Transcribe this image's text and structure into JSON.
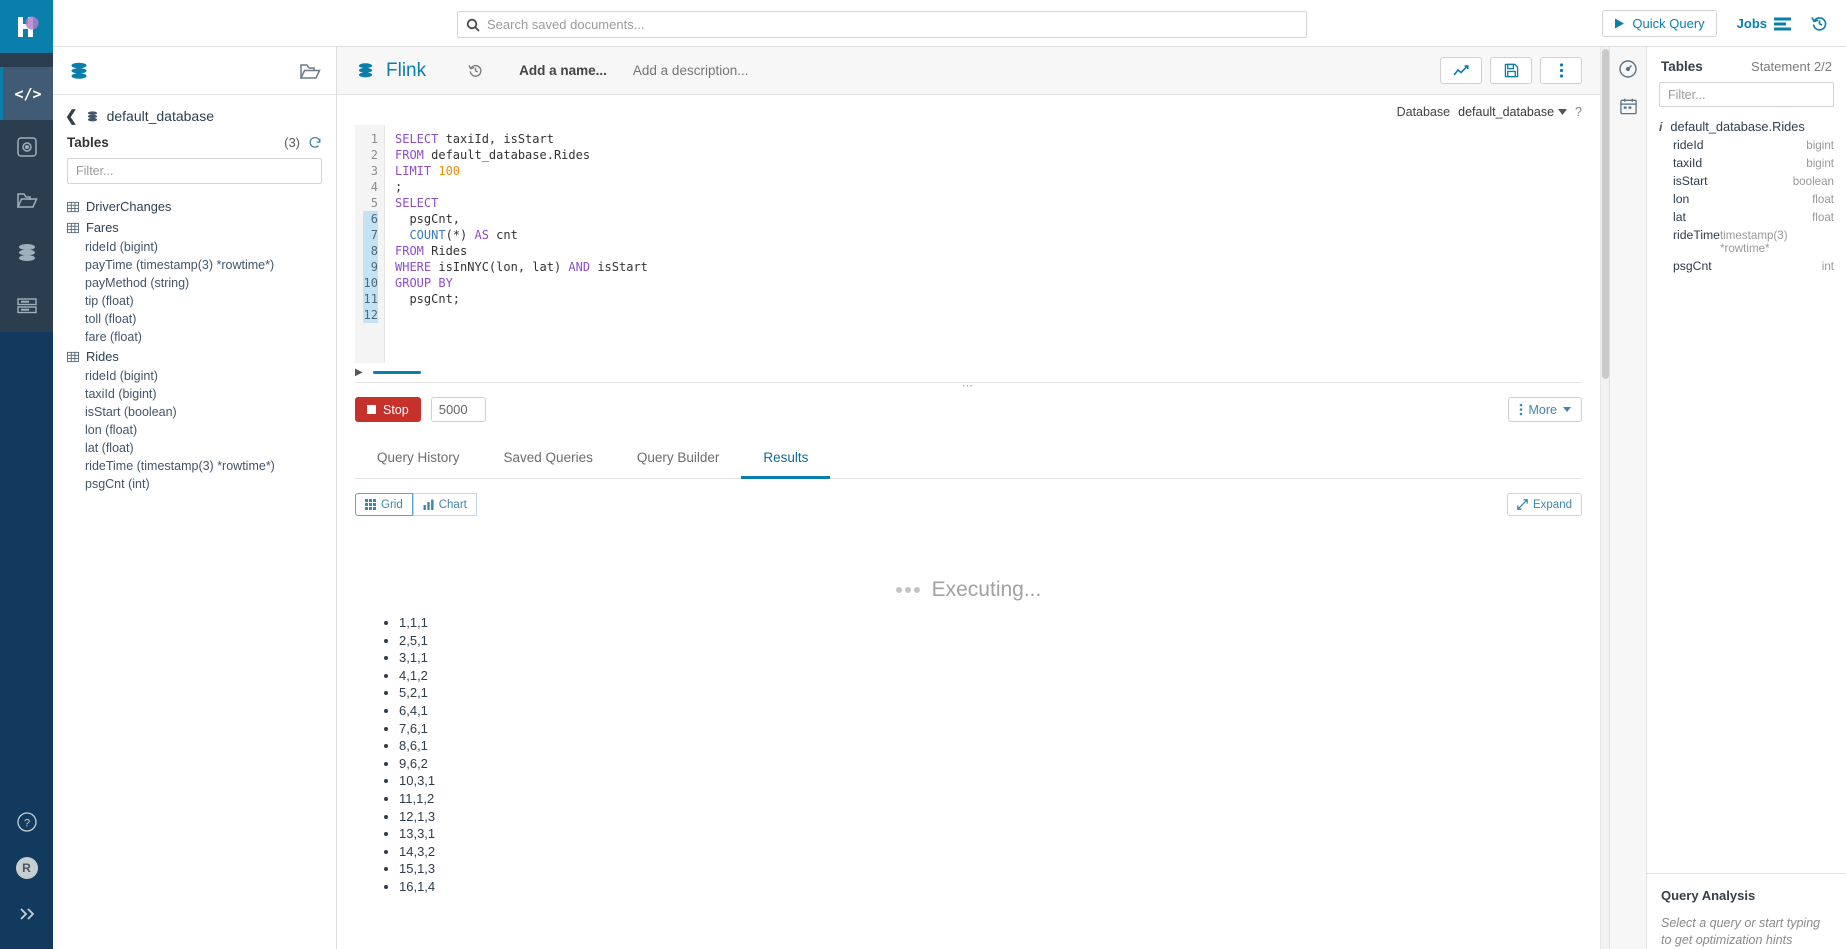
{
  "rail": {
    "logo": "hue-logo",
    "items": [
      {
        "name": "editor-icon",
        "glyph": "</>"
      },
      {
        "name": "dashboard-icon",
        "glyph": "dashboard"
      },
      {
        "name": "browser-icon",
        "glyph": "folder"
      },
      {
        "name": "tables-icon",
        "glyph": "database"
      },
      {
        "name": "jobs-icon",
        "glyph": "list"
      }
    ],
    "bottom": [
      {
        "name": "help-icon",
        "label": "?"
      },
      {
        "name": "user-avatar",
        "label": "R"
      },
      {
        "name": "expand-sidebar-icon",
        "label": "»"
      }
    ]
  },
  "topbar": {
    "search_placeholder": "Search saved documents...",
    "search_value": "",
    "quick_query_label": "Quick Query",
    "jobs_label": "Jobs",
    "history_icon": "history-icon"
  },
  "assist": {
    "open_folder_icon": "open-folder-icon",
    "db_icon": "database-icon",
    "database_name": "default_database",
    "tables_label": "Tables",
    "tables_count": "(3)",
    "refresh_icon": "refresh-icon",
    "filter_placeholder": "Filter...",
    "filter_value": "",
    "tables": [
      {
        "name": "DriverChanges",
        "columns": []
      },
      {
        "name": "Fares",
        "columns": [
          "rideId (bigint)",
          "payTime (timestamp(3) *rowtime*)",
          "payMethod (string)",
          "tip (float)",
          "toll (float)",
          "fare (float)"
        ]
      },
      {
        "name": "Rides",
        "columns": [
          "rideId (bigint)",
          "taxiId (bigint)",
          "isStart (boolean)",
          "lon (float)",
          "lat (float)",
          "rideTime (timestamp(3) *rowtime*)",
          "psgCnt (int)"
        ]
      }
    ]
  },
  "editor": {
    "title": "Flink",
    "history_icon": "history-icon",
    "name_placeholder": "Add a name...",
    "description_placeholder": "Add a description...",
    "actions": [
      {
        "name": "chart-toggle-button",
        "icon": "chart-line-icon"
      },
      {
        "name": "save-button",
        "icon": "save-disk-icon"
      },
      {
        "name": "more-options-button",
        "icon": "kebab-icon"
      }
    ],
    "database_label": "Database",
    "database_value": "default_database",
    "help_icon": "question-mark-icon",
    "code_lines": [
      {
        "n": 1,
        "selected": false,
        "tokens": [
          {
            "t": "SELECT",
            "c": "kw"
          },
          {
            "t": " taxiId, isStart",
            "c": "plain"
          }
        ]
      },
      {
        "n": 2,
        "selected": false,
        "tokens": [
          {
            "t": "FROM",
            "c": "kw"
          },
          {
            "t": " default_database.Rides",
            "c": "plain"
          }
        ]
      },
      {
        "n": 3,
        "selected": false,
        "tokens": [
          {
            "t": "LIMIT",
            "c": "kw"
          },
          {
            "t": " ",
            "c": "plain"
          },
          {
            "t": "100",
            "c": "num"
          }
        ]
      },
      {
        "n": 4,
        "selected": false,
        "tokens": [
          {
            "t": ";",
            "c": "plain"
          }
        ]
      },
      {
        "n": 5,
        "selected": false,
        "tokens": [
          {
            "t": "",
            "c": "plain"
          }
        ]
      },
      {
        "n": 6,
        "selected": true,
        "tokens": [
          {
            "t": "SELECT",
            "c": "kw"
          }
        ]
      },
      {
        "n": 7,
        "selected": true,
        "tokens": [
          {
            "t": "  psgCnt,",
            "c": "plain"
          }
        ]
      },
      {
        "n": 8,
        "selected": true,
        "tokens": [
          {
            "t": "  ",
            "c": "plain"
          },
          {
            "t": "COUNT",
            "c": "fn"
          },
          {
            "t": "(*) ",
            "c": "plain"
          },
          {
            "t": "AS",
            "c": "kw"
          },
          {
            "t": " cnt",
            "c": "plain"
          }
        ]
      },
      {
        "n": 9,
        "selected": true,
        "tokens": [
          {
            "t": "FROM",
            "c": "kw"
          },
          {
            "t": " Rides",
            "c": "plain"
          }
        ]
      },
      {
        "n": 10,
        "selected": true,
        "tokens": [
          {
            "t": "WHERE",
            "c": "kw"
          },
          {
            "t": " isInNYC(lon, lat) ",
            "c": "plain"
          },
          {
            "t": "AND",
            "c": "kw"
          },
          {
            "t": " isStart",
            "c": "plain"
          }
        ]
      },
      {
        "n": 11,
        "selected": true,
        "tokens": [
          {
            "t": "GROUP BY",
            "c": "kw"
          }
        ]
      },
      {
        "n": 12,
        "selected": true,
        "tokens": [
          {
            "t": "  psgCnt;",
            "c": "plain"
          }
        ]
      }
    ],
    "stop_label": "Stop",
    "limit_value": "5000",
    "more_label": "More",
    "tabs": [
      {
        "label": "Query History",
        "active": false
      },
      {
        "label": "Saved Queries",
        "active": false
      },
      {
        "label": "Query Builder",
        "active": false
      },
      {
        "label": "Results",
        "active": true
      }
    ],
    "grid_label": "Grid",
    "chart_label": "Chart",
    "expand_label": "Expand",
    "executing_label": "Executing...",
    "results": [
      "1,1,1",
      "2,5,1",
      "3,1,1",
      "4,1,2",
      "5,2,1",
      "6,4,1",
      "7,6,1",
      "8,6,1",
      "9,6,2",
      "10,3,1",
      "11,1,2",
      "12,1,3",
      "13,3,1",
      "14,3,2",
      "15,1,3",
      "16,1,4"
    ]
  },
  "rightrail": [
    {
      "name": "query-analysis-icon",
      "glyph": "gauge"
    },
    {
      "name": "schedule-icon",
      "glyph": "calendar"
    }
  ],
  "rightpanel": {
    "title": "Tables",
    "statement": "Statement 2/2",
    "filter_placeholder": "Filter...",
    "filter_value": "",
    "table_name": "default_database.Rides",
    "columns": [
      {
        "name": "rideId",
        "type": "bigint"
      },
      {
        "name": "taxiId",
        "type": "bigint"
      },
      {
        "name": "isStart",
        "type": "boolean"
      },
      {
        "name": "lon",
        "type": "float"
      },
      {
        "name": "lat",
        "type": "float"
      },
      {
        "name": "rideTime",
        "type": "timestamp(3) *rowtime*"
      },
      {
        "name": "psgCnt",
        "type": "int"
      }
    ],
    "analysis_title": "Query Analysis",
    "analysis_text": "Select a query or start typing to get optimization hints"
  },
  "colors": {
    "brand": "#0b7fab",
    "rail_bg": "#2a3e50",
    "rail_bottom": "#123a5e",
    "stop_red": "#c7312c",
    "keyword": "#8b4fc9",
    "number": "#e8900c",
    "function": "#3b7bbf"
  }
}
